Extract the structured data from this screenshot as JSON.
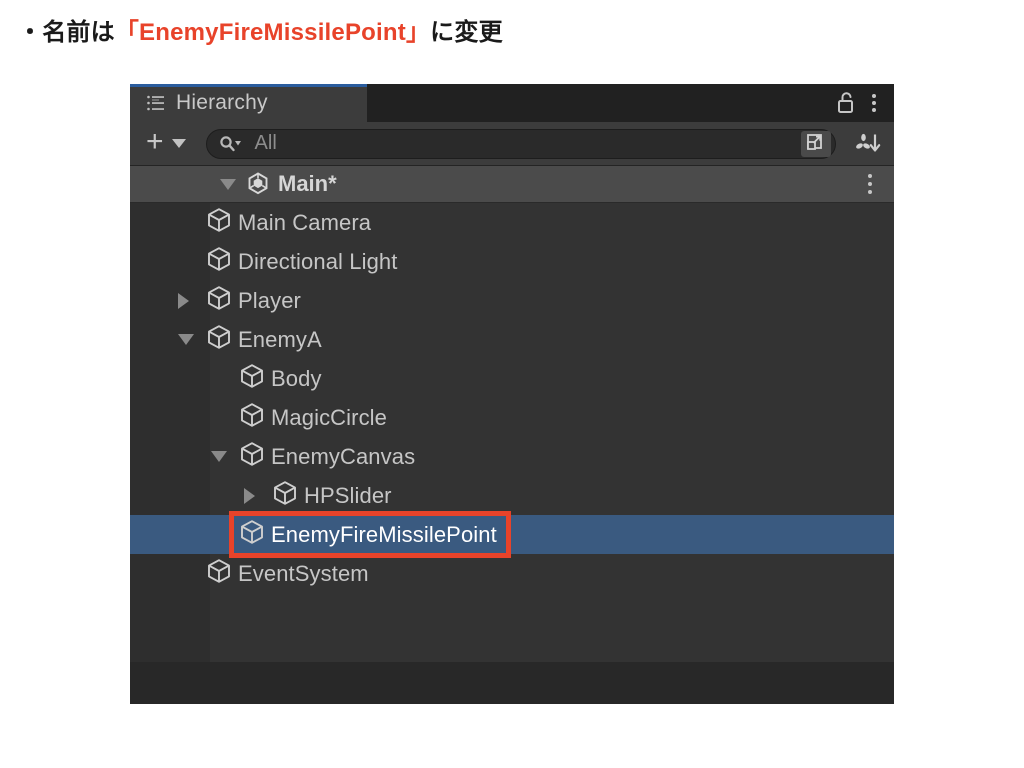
{
  "caption": {
    "bullet": "・",
    "prefix": "名前は",
    "open_quote": "「",
    "highlight": "EnemyFireMissilePoint",
    "close_quote": "」",
    "suffix": "に変更"
  },
  "panel": {
    "tab": {
      "label": "Hierarchy",
      "icon": "hierarchy-list-icon",
      "accent_color": "#2b5d9e"
    },
    "header_controls": {
      "lock_icon": "lock-open-icon",
      "menu_icon": "kebab-menu-icon"
    },
    "toolbar": {
      "add_label": "+",
      "add_dropdown_icon": "chevron-down-icon",
      "search": {
        "icon": "search-dropdown-icon",
        "placeholder": "All",
        "value": ""
      },
      "expand_icon": "expand-window-icon",
      "sort_icon": "sort-alphabetical-icon"
    },
    "scene": {
      "name": "Main*",
      "expanded": true,
      "icon": "unity-scene-icon",
      "menu_icon": "kebab-menu-icon"
    },
    "tree_rows": [
      {
        "name": "Main Camera",
        "depth": 1,
        "foldout": "none",
        "selected": false,
        "icon": "gameobject-cube-icon"
      },
      {
        "name": "Directional Light",
        "depth": 1,
        "foldout": "none",
        "selected": false,
        "icon": "gameobject-cube-icon"
      },
      {
        "name": "Player",
        "depth": 1,
        "foldout": "closed",
        "selected": false,
        "icon": "gameobject-cube-icon"
      },
      {
        "name": "EnemyA",
        "depth": 1,
        "foldout": "open",
        "selected": false,
        "icon": "gameobject-cube-icon"
      },
      {
        "name": "Body",
        "depth": 2,
        "foldout": "none",
        "selected": false,
        "icon": "gameobject-cube-icon"
      },
      {
        "name": "MagicCircle",
        "depth": 2,
        "foldout": "none",
        "selected": false,
        "icon": "gameobject-cube-icon"
      },
      {
        "name": "EnemyCanvas",
        "depth": 2,
        "foldout": "open",
        "selected": false,
        "icon": "gameobject-cube-icon"
      },
      {
        "name": "HPSlider",
        "depth": 3,
        "foldout": "closed",
        "selected": false,
        "icon": "gameobject-cube-icon"
      },
      {
        "name": "EnemyFireMissilePoint",
        "depth": 2,
        "foldout": "none",
        "selected": true,
        "icon": "gameobject-cube-icon"
      },
      {
        "name": "EventSystem",
        "depth": 1,
        "foldout": "none",
        "selected": false,
        "icon": "gameobject-cube-icon"
      }
    ],
    "colors": {
      "panel_bg": "#282828",
      "tree_bg": "#333333",
      "gutter_bg": "#2e2e2e",
      "selection_blue": "#3a5a80",
      "scene_row_bg": "#4b4b4b",
      "annotation_red": "#e8432a",
      "text": "#c6c6c6"
    }
  },
  "annotation": {
    "target_row": "EnemyFireMissilePoint",
    "color": "#e8432a"
  }
}
